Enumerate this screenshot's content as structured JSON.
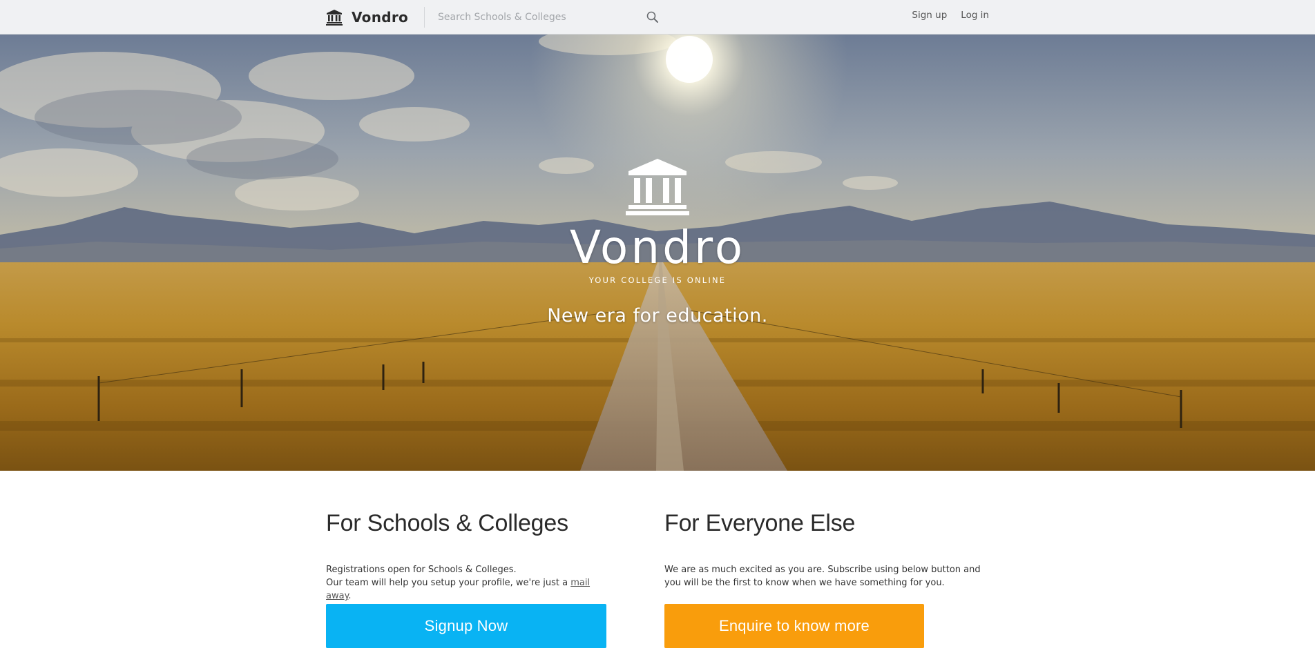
{
  "nav": {
    "brand_name": "Vondro",
    "search_placeholder": "Search Schools & Colleges",
    "signup_label": "Sign up",
    "login_label": "Log in",
    "brand_icon": "institution-icon",
    "search_icon": "search-icon"
  },
  "hero": {
    "logo_icon": "institution-icon",
    "title": "Vondro",
    "tagline": "YOUR COLLEGE IS ONLINE",
    "subtitle": "New era for education."
  },
  "schools": {
    "heading": "For Schools & Colleges",
    "line1": "Registrations open for Schools & Colleges.",
    "line2_prefix": "Our team will help you setup your profile, we're just a ",
    "line2_link": "mail away",
    "line2_suffix": ".",
    "button_label": "Signup Now"
  },
  "everyone": {
    "heading": "For Everyone Else",
    "text": "We are as much excited as you are. Subscribe using below button and you will be the first to know when we have something for you.",
    "button_label": "Enquire to know more"
  },
  "colors": {
    "nav_bg": "#f0f1f3",
    "signup_button": "#09b3f3",
    "enquire_button": "#f99d0c",
    "heading_text": "#2a2a2a"
  }
}
